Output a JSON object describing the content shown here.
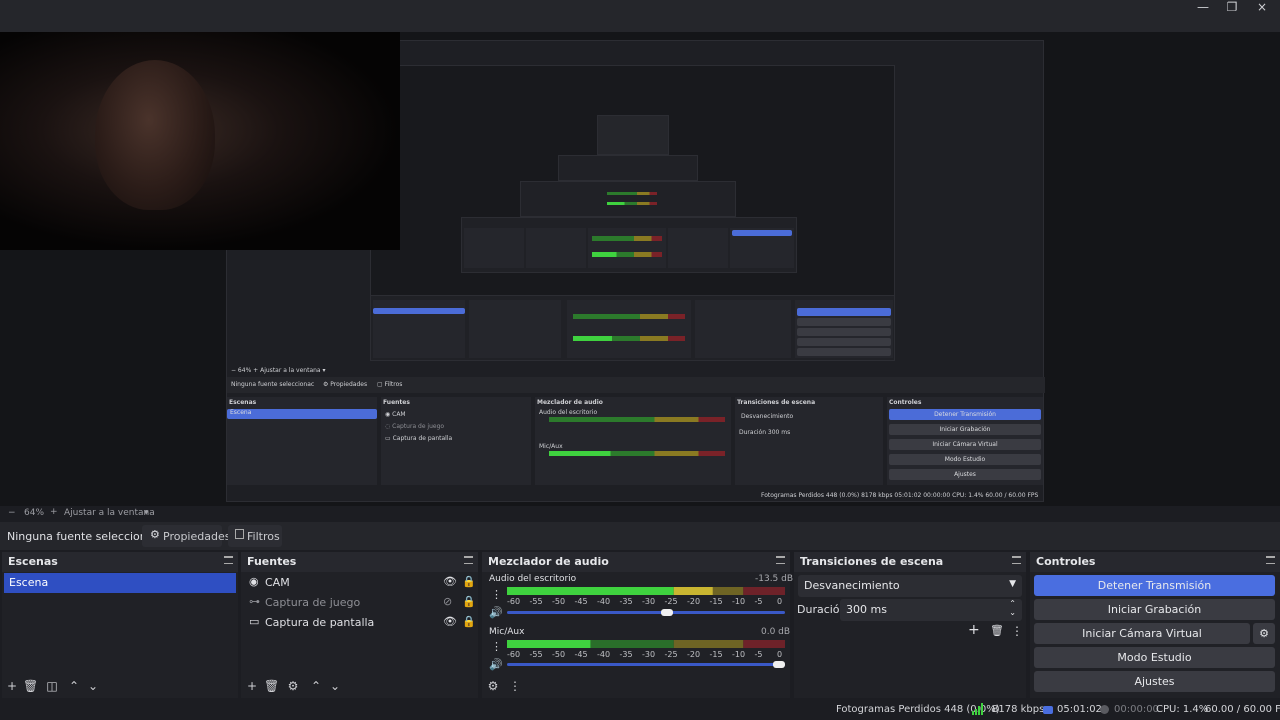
{
  "window": {
    "close_icon": "×",
    "restore_icon": "❐",
    "minimize_icon": "—"
  },
  "zoom": {
    "minus": "−",
    "level": "64%",
    "plus": "+",
    "fit_label": "Ajustar a la ventana"
  },
  "source_bar": {
    "no_source": "Ninguna fuente seleccionac",
    "properties": "Propiedades",
    "filters": "Filtros"
  },
  "scenes": {
    "title": "Escenas",
    "items": [
      "Escena"
    ]
  },
  "sources": {
    "title": "Fuentes",
    "items": [
      {
        "label": "CAM",
        "icon": "webcam-icon",
        "visible": true
      },
      {
        "label": "Captura de juego",
        "icon": "gamepad-icon",
        "visible": false
      },
      {
        "label": "Captura de pantalla",
        "icon": "monitor-icon",
        "visible": true
      }
    ]
  },
  "mixer": {
    "title": "Mezclador de audio",
    "channels": [
      {
        "name": "Audio del escritorio",
        "db": "-13.5 dB",
        "level": 0.74,
        "volume": 0.58
      },
      {
        "name": "Mic/Aux",
        "db": "0.0 dB",
        "level": 0.3,
        "volume": 1.0
      }
    ],
    "scale": [
      "-60",
      "-55",
      "-50",
      "-45",
      "-40",
      "-35",
      "-30",
      "-25",
      "-20",
      "-15",
      "-10",
      "-5",
      "0"
    ]
  },
  "transitions": {
    "title": "Transiciones de escena",
    "selected": "Desvanecimiento",
    "duration_label": "Duración",
    "duration_value": "300 ms"
  },
  "controls": {
    "title": "Controles",
    "stop_stream": "Detener Transmisión",
    "start_recording": "Iniciar Grabación",
    "start_virtual_cam": "Iniciar Cámara Virtual",
    "studio_mode": "Modo Estudio",
    "settings": "Ajustes"
  },
  "status": {
    "dropped_frames": "Fotogramas Perdidos 448 (0.0%)",
    "bitrate": "8178 kbps",
    "stream_time": "05:01:02",
    "rec_time": "00:00:00",
    "cpu": "CPU: 1.4%",
    "fps": "60.00 / 60.00 FPS"
  },
  "colors": {
    "accent": "#4a6ee0",
    "selected": "#2f4fc2",
    "meter_green": "#3fd23f",
    "meter_yellow": "#c9b531",
    "meter_red": "#c22f3a"
  }
}
